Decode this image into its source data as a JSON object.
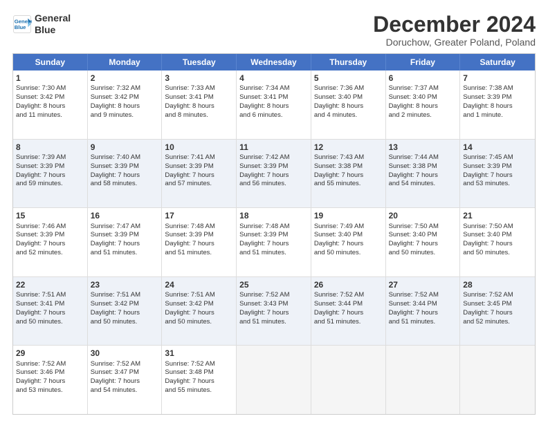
{
  "header": {
    "logo_line1": "General",
    "logo_line2": "Blue",
    "title": "December 2024",
    "subtitle": "Doruchow, Greater Poland, Poland"
  },
  "calendar": {
    "days_of_week": [
      "Sunday",
      "Monday",
      "Tuesday",
      "Wednesday",
      "Thursday",
      "Friday",
      "Saturday"
    ],
    "rows": [
      [
        {
          "day": "1",
          "lines": [
            "Sunrise: 7:30 AM",
            "Sunset: 3:42 PM",
            "Daylight: 8 hours",
            "and 11 minutes."
          ]
        },
        {
          "day": "2",
          "lines": [
            "Sunrise: 7:32 AM",
            "Sunset: 3:42 PM",
            "Daylight: 8 hours",
            "and 9 minutes."
          ]
        },
        {
          "day": "3",
          "lines": [
            "Sunrise: 7:33 AM",
            "Sunset: 3:41 PM",
            "Daylight: 8 hours",
            "and 8 minutes."
          ]
        },
        {
          "day": "4",
          "lines": [
            "Sunrise: 7:34 AM",
            "Sunset: 3:41 PM",
            "Daylight: 8 hours",
            "and 6 minutes."
          ]
        },
        {
          "day": "5",
          "lines": [
            "Sunrise: 7:36 AM",
            "Sunset: 3:40 PM",
            "Daylight: 8 hours",
            "and 4 minutes."
          ]
        },
        {
          "day": "6",
          "lines": [
            "Sunrise: 7:37 AM",
            "Sunset: 3:40 PM",
            "Daylight: 8 hours",
            "and 2 minutes."
          ]
        },
        {
          "day": "7",
          "lines": [
            "Sunrise: 7:38 AM",
            "Sunset: 3:39 PM",
            "Daylight: 8 hours",
            "and 1 minute."
          ]
        }
      ],
      [
        {
          "day": "8",
          "lines": [
            "Sunrise: 7:39 AM",
            "Sunset: 3:39 PM",
            "Daylight: 7 hours",
            "and 59 minutes."
          ]
        },
        {
          "day": "9",
          "lines": [
            "Sunrise: 7:40 AM",
            "Sunset: 3:39 PM",
            "Daylight: 7 hours",
            "and 58 minutes."
          ]
        },
        {
          "day": "10",
          "lines": [
            "Sunrise: 7:41 AM",
            "Sunset: 3:39 PM",
            "Daylight: 7 hours",
            "and 57 minutes."
          ]
        },
        {
          "day": "11",
          "lines": [
            "Sunrise: 7:42 AM",
            "Sunset: 3:39 PM",
            "Daylight: 7 hours",
            "and 56 minutes."
          ]
        },
        {
          "day": "12",
          "lines": [
            "Sunrise: 7:43 AM",
            "Sunset: 3:38 PM",
            "Daylight: 7 hours",
            "and 55 minutes."
          ]
        },
        {
          "day": "13",
          "lines": [
            "Sunrise: 7:44 AM",
            "Sunset: 3:38 PM",
            "Daylight: 7 hours",
            "and 54 minutes."
          ]
        },
        {
          "day": "14",
          "lines": [
            "Sunrise: 7:45 AM",
            "Sunset: 3:39 PM",
            "Daylight: 7 hours",
            "and 53 minutes."
          ]
        }
      ],
      [
        {
          "day": "15",
          "lines": [
            "Sunrise: 7:46 AM",
            "Sunset: 3:39 PM",
            "Daylight: 7 hours",
            "and 52 minutes."
          ]
        },
        {
          "day": "16",
          "lines": [
            "Sunrise: 7:47 AM",
            "Sunset: 3:39 PM",
            "Daylight: 7 hours",
            "and 51 minutes."
          ]
        },
        {
          "day": "17",
          "lines": [
            "Sunrise: 7:48 AM",
            "Sunset: 3:39 PM",
            "Daylight: 7 hours",
            "and 51 minutes."
          ]
        },
        {
          "day": "18",
          "lines": [
            "Sunrise: 7:48 AM",
            "Sunset: 3:39 PM",
            "Daylight: 7 hours",
            "and 51 minutes."
          ]
        },
        {
          "day": "19",
          "lines": [
            "Sunrise: 7:49 AM",
            "Sunset: 3:40 PM",
            "Daylight: 7 hours",
            "and 50 minutes."
          ]
        },
        {
          "day": "20",
          "lines": [
            "Sunrise: 7:50 AM",
            "Sunset: 3:40 PM",
            "Daylight: 7 hours",
            "and 50 minutes."
          ]
        },
        {
          "day": "21",
          "lines": [
            "Sunrise: 7:50 AM",
            "Sunset: 3:40 PM",
            "Daylight: 7 hours",
            "and 50 minutes."
          ]
        }
      ],
      [
        {
          "day": "22",
          "lines": [
            "Sunrise: 7:51 AM",
            "Sunset: 3:41 PM",
            "Daylight: 7 hours",
            "and 50 minutes."
          ]
        },
        {
          "day": "23",
          "lines": [
            "Sunrise: 7:51 AM",
            "Sunset: 3:42 PM",
            "Daylight: 7 hours",
            "and 50 minutes."
          ]
        },
        {
          "day": "24",
          "lines": [
            "Sunrise: 7:51 AM",
            "Sunset: 3:42 PM",
            "Daylight: 7 hours",
            "and 50 minutes."
          ]
        },
        {
          "day": "25",
          "lines": [
            "Sunrise: 7:52 AM",
            "Sunset: 3:43 PM",
            "Daylight: 7 hours",
            "and 51 minutes."
          ]
        },
        {
          "day": "26",
          "lines": [
            "Sunrise: 7:52 AM",
            "Sunset: 3:44 PM",
            "Daylight: 7 hours",
            "and 51 minutes."
          ]
        },
        {
          "day": "27",
          "lines": [
            "Sunrise: 7:52 AM",
            "Sunset: 3:44 PM",
            "Daylight: 7 hours",
            "and 51 minutes."
          ]
        },
        {
          "day": "28",
          "lines": [
            "Sunrise: 7:52 AM",
            "Sunset: 3:45 PM",
            "Daylight: 7 hours",
            "and 52 minutes."
          ]
        }
      ],
      [
        {
          "day": "29",
          "lines": [
            "Sunrise: 7:52 AM",
            "Sunset: 3:46 PM",
            "Daylight: 7 hours",
            "and 53 minutes."
          ]
        },
        {
          "day": "30",
          "lines": [
            "Sunrise: 7:52 AM",
            "Sunset: 3:47 PM",
            "Daylight: 7 hours",
            "and 54 minutes."
          ]
        },
        {
          "day": "31",
          "lines": [
            "Sunrise: 7:52 AM",
            "Sunset: 3:48 PM",
            "Daylight: 7 hours",
            "and 55 minutes."
          ]
        },
        {
          "day": "",
          "lines": []
        },
        {
          "day": "",
          "lines": []
        },
        {
          "day": "",
          "lines": []
        },
        {
          "day": "",
          "lines": []
        }
      ]
    ]
  }
}
